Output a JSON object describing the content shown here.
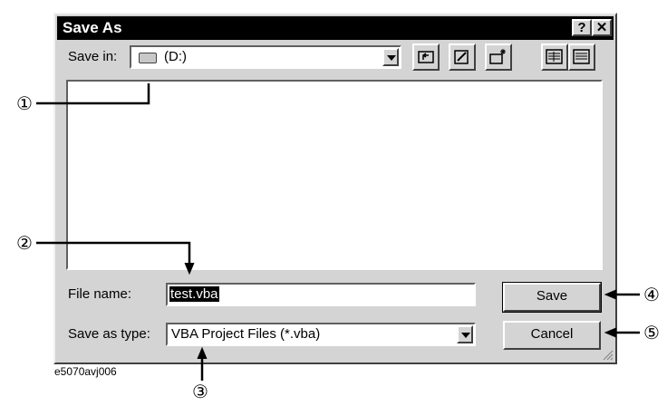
{
  "window": {
    "title": "Save As",
    "help_label": "?",
    "close_label": "✕"
  },
  "save_in": {
    "label": "Save in:",
    "value": "(D:)",
    "drive_icon": "drive-icon"
  },
  "toolbar": {
    "icons": [
      "up-one-level-icon",
      "desktop-icon",
      "new-folder-icon",
      "list-view-icon",
      "details-view-icon"
    ]
  },
  "file_name": {
    "label": "File name:",
    "value": "test.vba"
  },
  "save_as_type": {
    "label": "Save as type:",
    "value": "VBA Project Files (*.vba)"
  },
  "buttons": {
    "save": "Save",
    "cancel": "Cancel"
  },
  "callouts": [
    "①",
    "②",
    "③",
    "④",
    "⑤"
  ],
  "caption": "e5070avj006"
}
